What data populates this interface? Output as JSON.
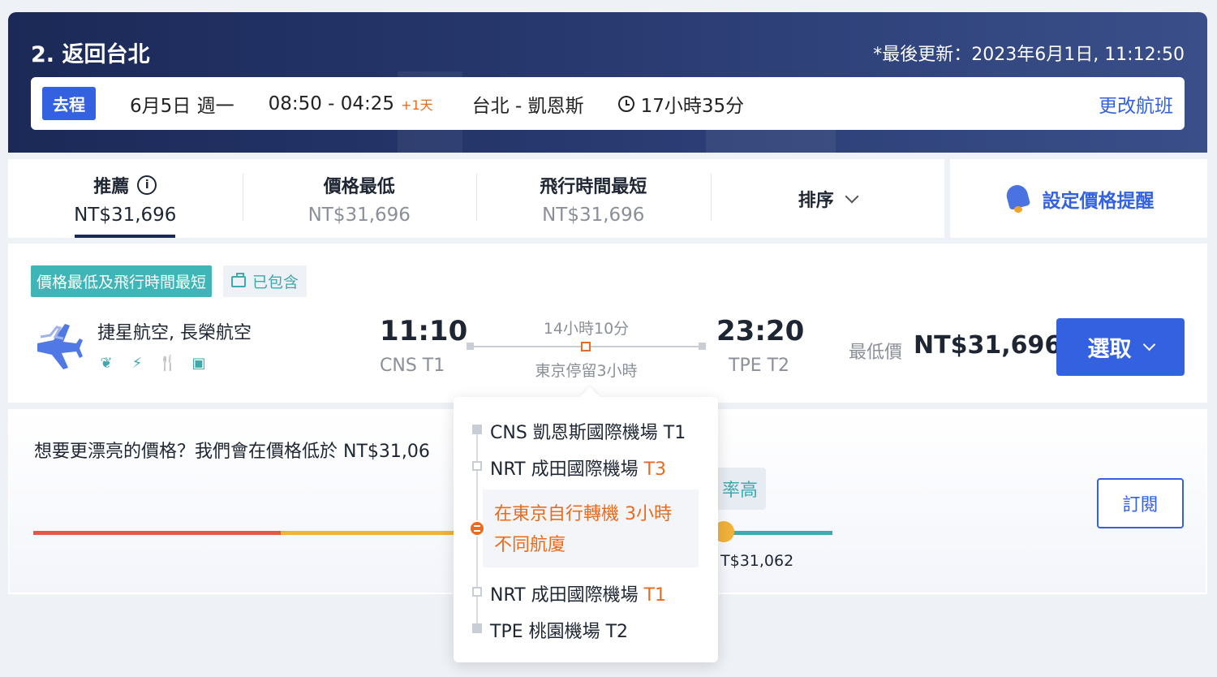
{
  "header": {
    "title": "2. 返回台北",
    "last_updated": "*最後更新：2023年6月1日, 11:12:50"
  },
  "trip": {
    "direction_tag": "去程",
    "date": "6月5日 週一",
    "times": "08:50 - 04:25",
    "day_offset": "+1天",
    "route": "台北 - 凱恩斯",
    "duration": "17小時35分",
    "change_label": "更改航班"
  },
  "sort_tabs": [
    {
      "label": "推薦",
      "price": "NT$31,696"
    },
    {
      "label": "價格最低",
      "price": "NT$31,696"
    },
    {
      "label": "飛行時間最短",
      "price": "NT$31,696"
    },
    {
      "label": "排序",
      "price": ""
    }
  ],
  "price_alert": {
    "label": "設定價格提醒"
  },
  "flight": {
    "badge_best": "價格最低及飛行時間最短",
    "badge_included": "已包含",
    "airlines": "捷星航空, 長榮航空",
    "amenity_icons": [
      "leaf-icon",
      "power-icon",
      "meal-icon",
      "entertainment-icon"
    ],
    "departure_time": "11:10",
    "departure_airport": "CNS T1",
    "duration": "14小時10分",
    "stopover": "東京停留3小時",
    "arrival_time": "23:20",
    "arrival_airport": "TPE T2",
    "price_label": "最低價",
    "price": "NT$31,696",
    "select_label": "選取"
  },
  "subscribe": {
    "text": "想要更漂亮的價格？我們會在價格低於 NT$31,06",
    "hint_partial": "率高",
    "bar_price_partial": "T$31,062",
    "button_label": "訂閱"
  },
  "stop_popover": {
    "first": "CNS 凱恩斯國際機場 T1",
    "second_name": "NRT 成田國際機場",
    "second_terminal": "T3",
    "transfer_line1": "在東京自行轉機 3小時",
    "transfer_line2": "不同航廈",
    "third_name": "NRT 成田國際機場",
    "third_terminal": "T1",
    "fourth": "TPE 桃園機場 T2"
  },
  "colors": {
    "brand_blue": "#3361e0",
    "header_navy": "#1b2957",
    "teal": "#3fb5b8",
    "orange": "#ea6b1e"
  }
}
